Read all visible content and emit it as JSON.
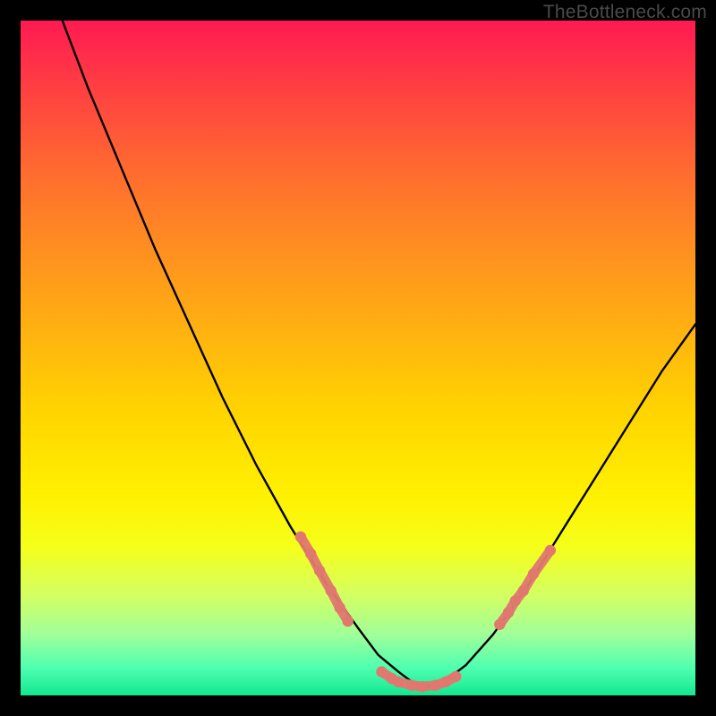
{
  "watermark": "TheBottleneck.com",
  "colors": {
    "background": "#000000",
    "curve_black": "#000000",
    "marker_fill": "#e07870",
    "marker_stroke": "#d46a62"
  },
  "chart_data": {
    "type": "line",
    "title": "",
    "xlabel": "",
    "ylabel": "",
    "xlim": [
      0,
      100
    ],
    "ylim": [
      0,
      100
    ],
    "series": [
      {
        "name": "left-branch",
        "x": [
          6.2,
          10,
          15,
          20,
          25,
          30,
          35,
          40,
          45,
          50,
          53,
          56,
          58,
          60
        ],
        "y": [
          100,
          90,
          78,
          66,
          55,
          44,
          34,
          25,
          17,
          10,
          6,
          3.5,
          2,
          1.3
        ]
      },
      {
        "name": "right-branch",
        "x": [
          60,
          63,
          66,
          70,
          75,
          80,
          85,
          90,
          95,
          100
        ],
        "y": [
          1.3,
          2.2,
          4.5,
          9,
          16,
          24,
          32,
          40,
          48,
          55
        ]
      }
    ],
    "markers": {
      "name": "highlighted-points",
      "points": [
        {
          "x": 41.5,
          "y": 23.5
        },
        {
          "x": 43.0,
          "y": 21.0
        },
        {
          "x": 44.3,
          "y": 18.5
        },
        {
          "x": 46.0,
          "y": 15.5
        },
        {
          "x": 47.3,
          "y": 13.0
        },
        {
          "x": 48.5,
          "y": 11.0
        },
        {
          "x": 53.5,
          "y": 3.5
        },
        {
          "x": 55.0,
          "y": 2.5
        },
        {
          "x": 56.0,
          "y": 2.0
        },
        {
          "x": 58.0,
          "y": 1.5
        },
        {
          "x": 59.5,
          "y": 1.3
        },
        {
          "x": 61.5,
          "y": 1.5
        },
        {
          "x": 63.0,
          "y": 2.0
        },
        {
          "x": 64.5,
          "y": 2.8
        },
        {
          "x": 71.0,
          "y": 10.5
        },
        {
          "x": 72.3,
          "y": 12.3
        },
        {
          "x": 73.3,
          "y": 14.0
        },
        {
          "x": 74.5,
          "y": 15.5
        },
        {
          "x": 76.0,
          "y": 18.0
        },
        {
          "x": 78.5,
          "y": 21.5
        }
      ]
    }
  }
}
